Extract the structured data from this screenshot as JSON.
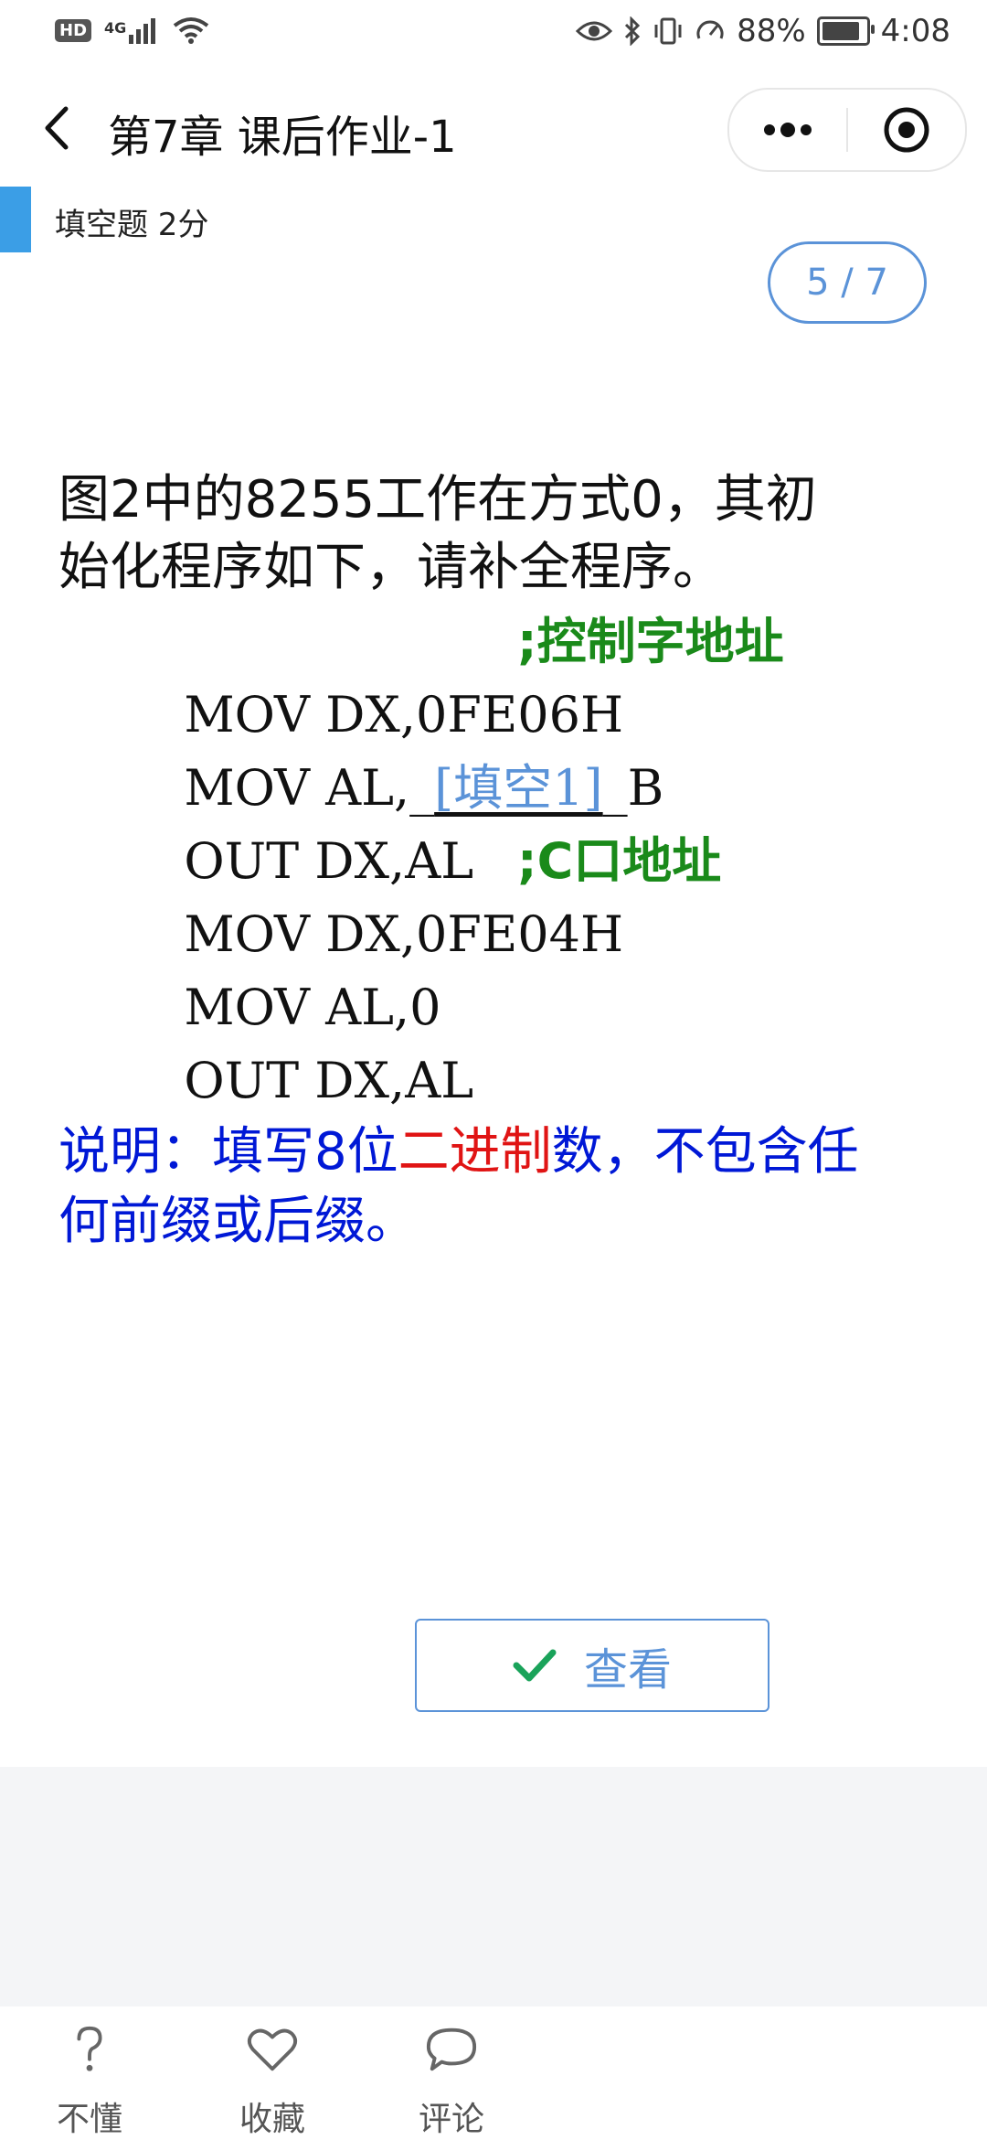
{
  "status_bar": {
    "hd": "HD",
    "network": "4G",
    "battery_percent": "88%",
    "battery_level": 0.88,
    "time": "4:08"
  },
  "nav": {
    "title": "第7章 课后作业-1"
  },
  "question": {
    "type_label": "填空题 2分",
    "progress": "5 / 7",
    "text": "图2中的8255工作在方式0，其初始化程序如下，请补全程序。",
    "code": [
      {
        "code": "MOV DX,0FE06H",
        "comment": ";控制字地址"
      },
      {
        "prefix": "MOV AL,_",
        "blank": "[填空1]",
        "suffix": "_B"
      },
      {
        "code": "OUT DX,AL"
      },
      {
        "code": "MOV DX,0FE04H",
        "comment": ";C口地址"
      },
      {
        "code": "MOV AL,0"
      },
      {
        "code": "OUT DX,AL"
      }
    ],
    "note_part1": "说明：填写8位",
    "note_red": "二进制",
    "note_part2": "数，不包含任何前缀或后缀。"
  },
  "check_button": {
    "label": "查看",
    "icon": "check-icon"
  },
  "bottom_tabs": [
    {
      "label": "不懂",
      "icon": "question-icon"
    },
    {
      "label": "收藏",
      "icon": "heart-icon"
    },
    {
      "label": "评论",
      "icon": "comment-icon"
    }
  ],
  "colors": {
    "accent": "#3b9ee6",
    "link_blue": "#5b93d8",
    "comment_green": "#1a8a1a",
    "note_blue": "#0018d6",
    "note_red": "#e01414",
    "check_green": "#1aa35a"
  }
}
